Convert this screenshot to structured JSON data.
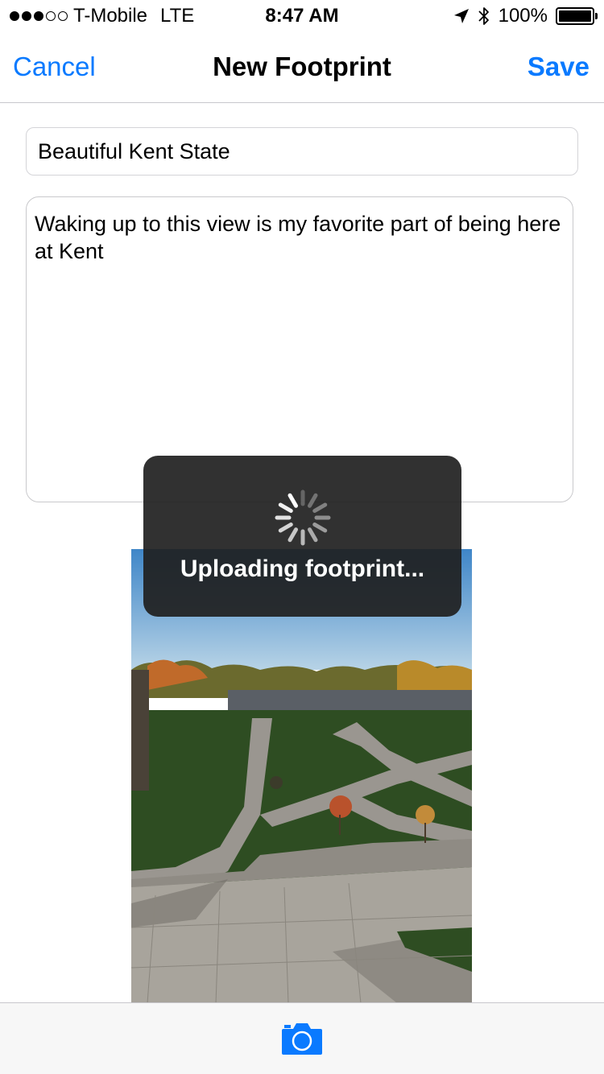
{
  "status_bar": {
    "signal_bars_filled": 3,
    "signal_bars_total": 5,
    "carrier": "T-Mobile",
    "network": "LTE",
    "time": "8:47 AM",
    "battery": "100%",
    "battery_level": 1.0,
    "icons": [
      "location-arrow-icon",
      "bluetooth-icon",
      "battery-icon"
    ]
  },
  "nav": {
    "cancel_label": "Cancel",
    "title": "New Footprint",
    "save_label": "Save"
  },
  "form": {
    "title_value": "Beautiful Kent State",
    "description_value": "Waking up to this view is my favorite part of being here at Kent"
  },
  "hud": {
    "message": "Uploading footprint..."
  },
  "toolbar": {
    "icon": "camera-icon"
  },
  "colors": {
    "accent": "#0a7aff",
    "hud_background": "#202020"
  }
}
